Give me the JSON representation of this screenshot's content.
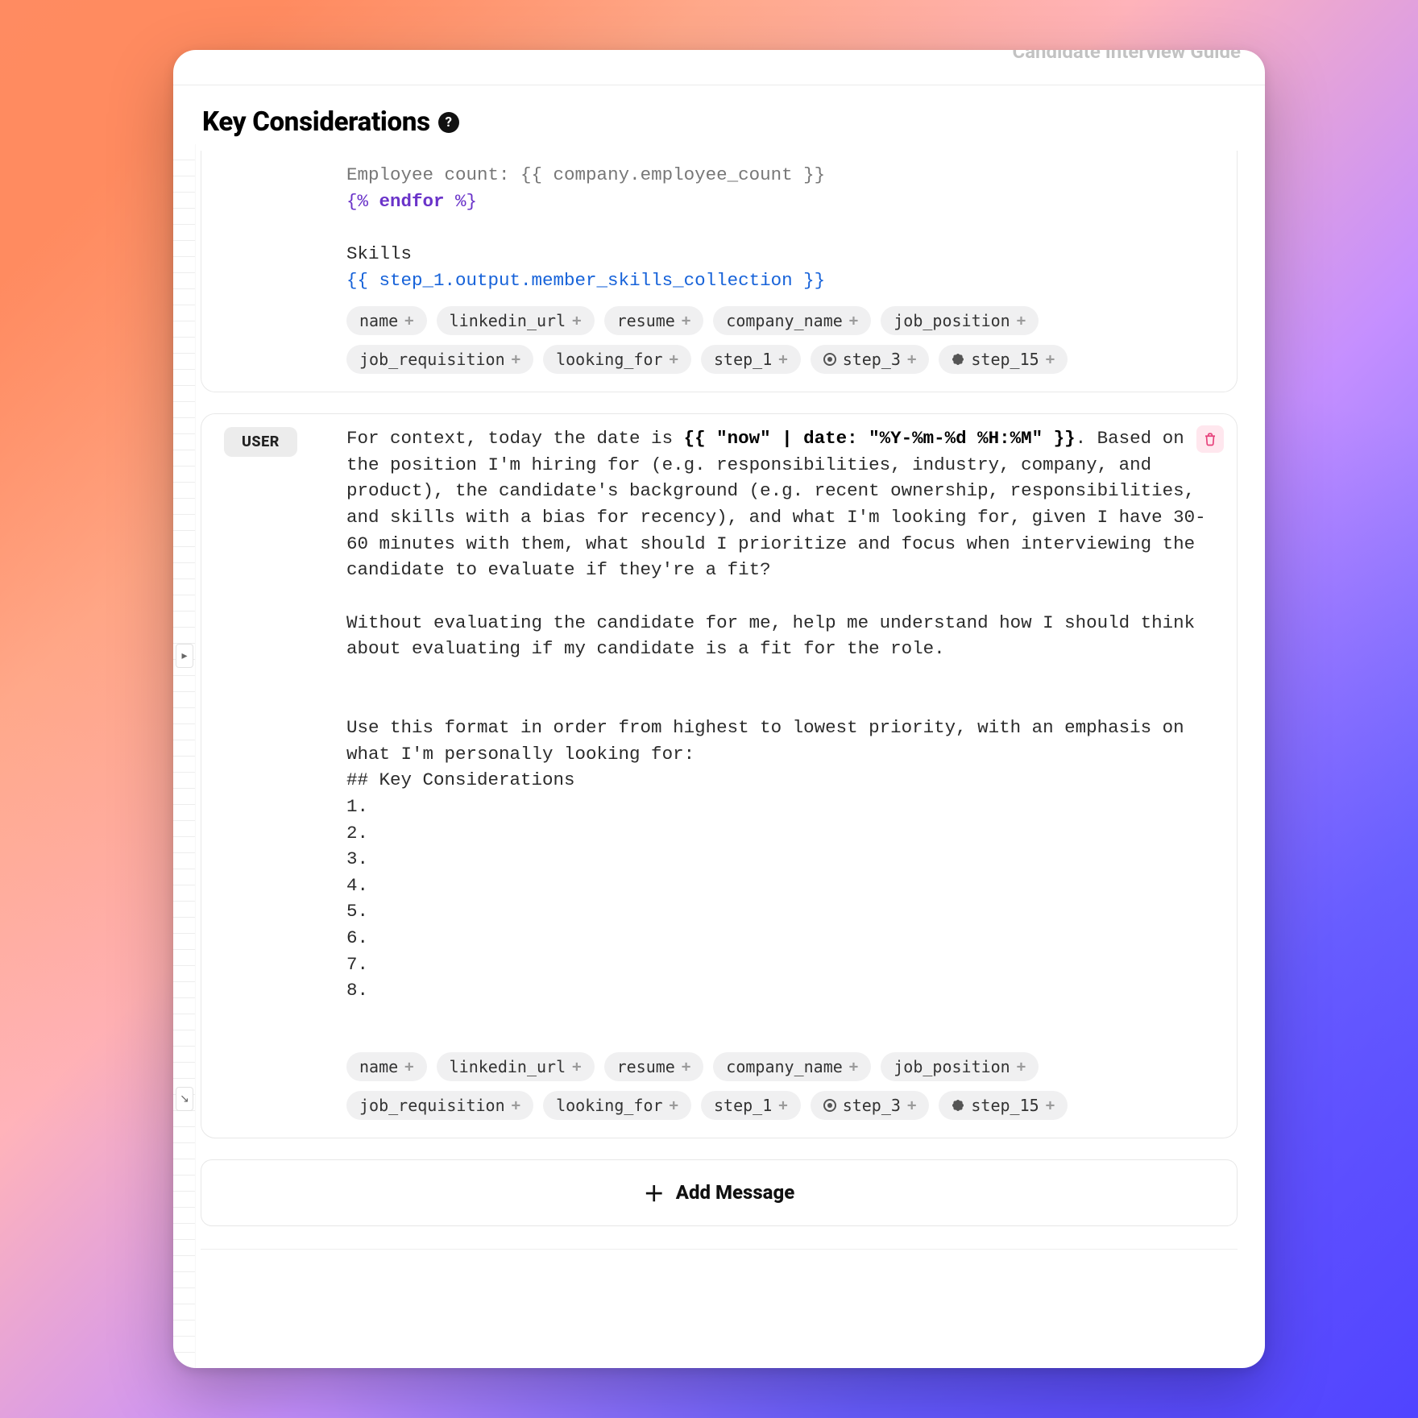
{
  "topbar": {
    "breadcrumb_title": "Candidate Interview Guide"
  },
  "header": {
    "title": "Key Considerations",
    "help_tooltip": "?"
  },
  "system_card": {
    "code_line1_prefix": "Employee count: ",
    "code_line1_var": "{{ company.employee_count }}",
    "code_line2_open": "{% ",
    "code_line2_kw": "endfor",
    "code_line2_close": " %}",
    "skills_heading": "Skills",
    "skills_ref_open": "{{ ",
    "skills_ref": "step_1.output.member_skills_collection",
    "skills_ref_close": " }}",
    "chips_row1": [
      "name",
      "linkedin_url",
      "resume",
      "company_name",
      "job_position"
    ],
    "chips_row2": [
      "job_requisition",
      "looking_for",
      "step_1"
    ],
    "chip_step3": "step_3",
    "chip_step15": "step_15"
  },
  "user_card": {
    "role": "USER",
    "prefix": "For context, today the date is ",
    "date_expr": "{{ \"now\" | date: \"%Y-%m-%d %H:%M\" }}",
    "body_after": ". Based on the position I'm hiring for (e.g. responsibilities, industry, company, and product), the candidate's background (e.g. recent ownership, responsibilities, and skills with a bias for recency), and what I'm looking for, given I have 30-60 minutes with them, what should I prioritize and focus when interviewing the candidate to evaluate if they're a fit?",
    "para2": "Without evaluating the candidate for me, help me understand how I should think about evaluating if my candidate is a fit for the role.",
    "para3": "Use this format in order from highest to lowest priority, with an emphasis on what I'm personally looking for:",
    "format_heading": "## Key Considerations",
    "numbers": [
      "1.",
      "2.",
      "3.",
      "4.",
      "5.",
      "6.",
      "7.",
      "8."
    ],
    "chips_row1": [
      "name",
      "linkedin_url",
      "resume",
      "company_name",
      "job_position"
    ],
    "chips_row2": [
      "job_requisition",
      "looking_for",
      "step_1"
    ],
    "chip_step3": "step_3",
    "chip_step15": "step_15"
  },
  "add_message_label": "Add Message"
}
